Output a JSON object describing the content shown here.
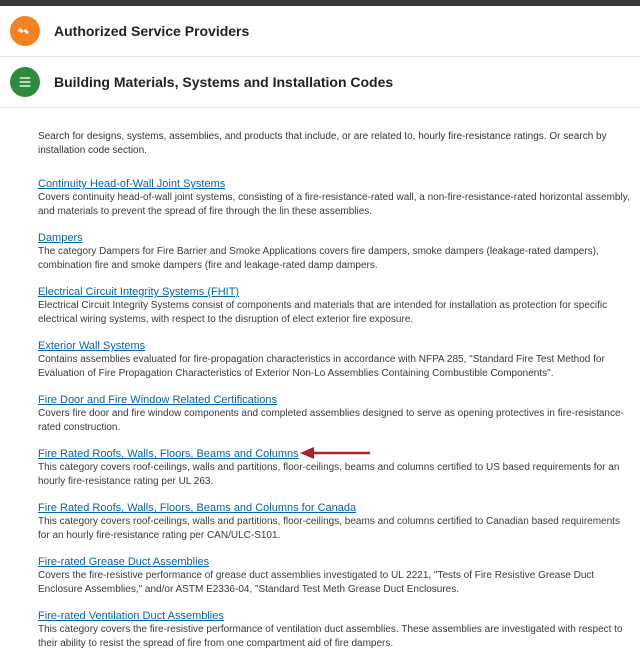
{
  "header1": {
    "title": "Authorized Service Providers"
  },
  "header2": {
    "title": "Building Materials, Systems and Installation Codes"
  },
  "intro": "Search for designs, systems, assemblies, and products that include, or are related to, hourly fire-resistance ratings. Or search by installation code section.",
  "entries": [
    {
      "title": "Continuity Head-of-Wall Joint Systems",
      "desc": "Covers continuity head-of-wall joint systems, consisting of a fire-resistance-rated wall, a non-fire-resistance-rated horizontal assembly, and materials to prevent the spread of fire through the lin these assemblies."
    },
    {
      "title": "Dampers",
      "desc": "The category Dampers for Fire Barrier and Smoke Applications covers fire dampers, smoke dampers (leakage-rated dampers), combination fire and smoke dampers (fire and leakage-rated damp dampers."
    },
    {
      "title": "Electrical Circuit Integrity Systems (FHIT)",
      "desc": "Electrical Circuit Integrity Systems consist of components and materials that are intended for installation as protection for specific electrical wiring systems, with respect to the disruption of elect exterior fire exposure."
    },
    {
      "title": "Exterior Wall Systems",
      "desc": "Contains assemblies evaluated for fire-propagation characteristics in accordance with NFPA 285, \"Standard Fire Test Method for Evaluation of Fire Propagation Characteristics of Exterior Non-Lo Assemblies Containing Combustible Components\"."
    },
    {
      "title": "Fire Door and Fire Window Related Certifications",
      "desc": "Covers fire door and fire window components and completed assemblies designed to serve as opening protectives in fire-resistance-rated construction."
    },
    {
      "title": "Fire Rated Roofs, Walls, Floors, Beams and Columns",
      "desc": "This category covers roof-ceilings, walls and partitions, floor-ceilings, beams and columns certified to US based requirements for an hourly fire-resistance rating per UL 263."
    },
    {
      "title": "Fire Rated Roofs, Walls, Floors, Beams and Columns for Canada",
      "desc": "This category covers roof-ceilings, walls and partitions, floor-ceilings, beams and columns certified to Canadian based requirements for an hourly fire-resistance rating per CAN/ULC-S101."
    },
    {
      "title": "Fire-rated Grease Duct Assemblies",
      "desc": "Covers the fire-resistive performance of grease duct assemblies investigated to UL 2221, \"Tests of Fire Resistive Grease Duct Enclosure Assemblies,\" and/or ASTM E2336-04, \"Standard Test Meth Grease Duct Enclosures."
    },
    {
      "title": "Fire-rated Ventilation Duct Assemblies",
      "desc": "This category covers the fire-resistive performance of ventilation duct assemblies. These assemblies are investigated with respect to their ability to resist the spread of fire from one compartment aid of fire dampers."
    }
  ]
}
